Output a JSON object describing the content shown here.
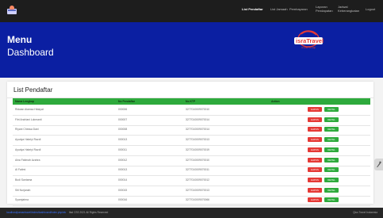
{
  "topbar": {
    "nav": [
      {
        "label": "List Pendaftar",
        "active": true
      },
      {
        "label": "List Jamaah",
        "active": false
      },
      {
        "label": "Pembayaran",
        "active": false
      },
      {
        "label": "Laporan Pendapatan",
        "active": false
      },
      {
        "label": "Jadwal Keberangkatan",
        "active": false
      },
      {
        "label": "Logout",
        "active": false
      }
    ]
  },
  "hero": {
    "title": "Menu",
    "subtitle": "Dashboard",
    "brand_name": "israTravel",
    "brand_tagline": "Umrah & Haji"
  },
  "panel": {
    "title": "List Pendaftar"
  },
  "table": {
    "headers": [
      "Nama Lengkap",
      "No Pendaftar",
      "No KTP",
      "Action"
    ],
    "rows": [
      {
        "nama": "Ridwan Alamsa Hidayat",
        "no": "000006",
        "ktp": "3277010009070010"
      },
      {
        "nama": "Fitri Andriani Lukmanti",
        "no": "000007",
        "ktp": "3277010009070014"
      },
      {
        "nama": "Riyani Chessa Dani",
        "no": "000008",
        "ktp": "3277010009070014"
      },
      {
        "nama": "Ayudya Habriyi Razdi",
        "no": "000013",
        "ktp": "3277010009070013"
      },
      {
        "nama": "Ayudya Habriyi Razdi",
        "no": "000011",
        "ktp": "3277010009070019"
      },
      {
        "nama": "Aina Fatimah Azahra",
        "no": "000012",
        "ktp": "3277010009070010"
      },
      {
        "nama": "Al Fatimi",
        "no": "000013",
        "ktp": "3277010009070011"
      },
      {
        "nama": "Budi Santama",
        "no": "000014",
        "ktp": "3277010009070012"
      },
      {
        "nama": "Siti Nurjanah",
        "no": "000015",
        "ktp": "3277010009070013"
      },
      {
        "nama": "Syamjatma",
        "no": "000016",
        "ktp": "3277010009070066"
      }
    ],
    "btn_hapus": "HAPUS",
    "btn_detail": "DETAIL"
  },
  "footer": {
    "link_text": "localhost/pamantravel/index/dashboard/index.phpinfo",
    "copyright": "Ifad CSS 2021 All Rights Reserved",
    "right_text": "Qius Travel Indonesia"
  },
  "colors": {
    "topbar": "#1d1d1d",
    "hero": "#0b1fa2",
    "table_header": "#2eaa3c",
    "hapus": "#e53935",
    "detail": "#2eaa3c"
  }
}
